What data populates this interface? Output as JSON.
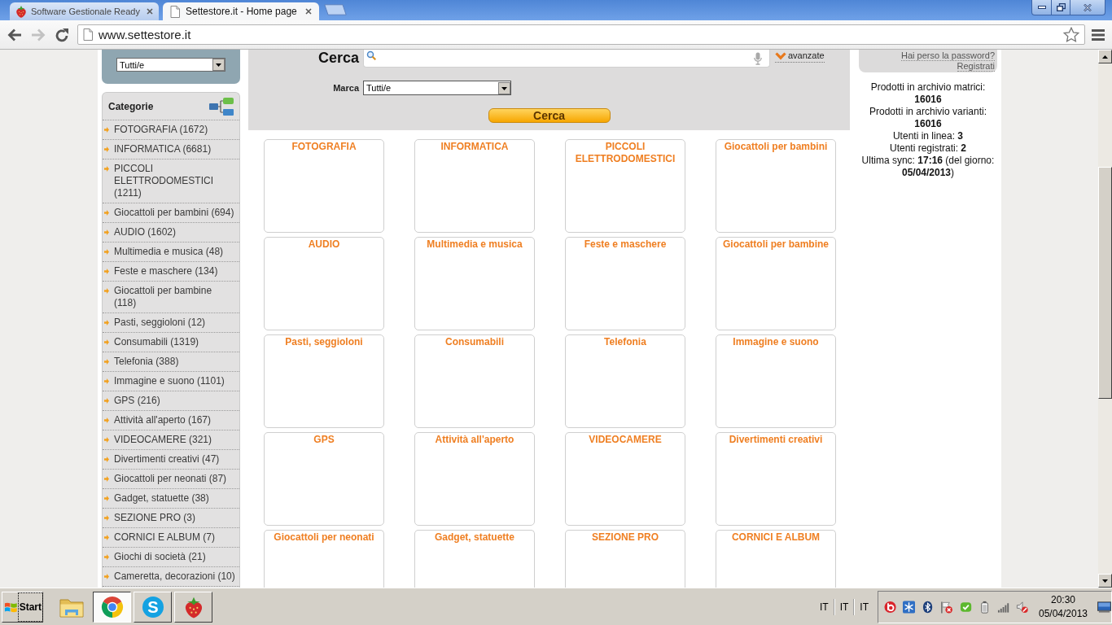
{
  "browser": {
    "tabs": [
      {
        "kind": "app",
        "title": "Software Gestionale Ready",
        "selected": false
      },
      {
        "kind": "page",
        "title": "Settestore.it - Home page",
        "selected": true
      }
    ],
    "nav": [
      {
        "kind": "back",
        "disabled": false
      },
      {
        "kind": "forward",
        "disabled": true
      },
      {
        "kind": "reload",
        "disabled": false
      }
    ],
    "address": "www.settestore.it"
  },
  "sidebar": {
    "filter_select": "Tutti/e",
    "categories_title": "Categorie",
    "items": [
      "FOTOGRAFIA (1672)",
      "INFORMATICA (6681)",
      "PICCOLI ELETTRODOMESTICI (1211)",
      "Giocattoli per bambini (694)",
      "AUDIO (1602)",
      "Multimedia e musica (48)",
      "Feste e maschere (134)",
      "Giocattoli per bambine (118)",
      "Pasti, seggioloni (12)",
      "Consumabili (1319)",
      "Telefonia (388)",
      "Immagine e suono (1101)",
      "GPS (216)",
      "Attività all'aperto (167)",
      "VIDEOCAMERE (321)",
      "Divertimenti creativi (47)",
      "Giocattoli per neonati (87)",
      "Gadget, statuette (38)",
      "SEZIONE PRO (3)",
      "CORNICI E ALBUM (7)",
      "Giochi di società (21)",
      "Cameretta, decorazioni (10)"
    ]
  },
  "search": {
    "label": "Cerca",
    "advanced_link": "avanzate",
    "brand_label": "Marca",
    "brand_select": "Tutti/e",
    "button": "Cerca"
  },
  "category_tiles": [
    "FOTOGRAFIA",
    "INFORMATICA",
    "PICCOLI ELETTRODOMESTICI",
    "Giocattoli per bambini",
    "AUDIO",
    "Multimedia e musica",
    "Feste e maschere",
    "Giocattoli per bambine",
    "Pasti, seggioloni",
    "Consumabili",
    "Telefonia",
    "Immagine e suono",
    "GPS",
    "Attività all'aperto",
    "VIDEOCAMERE",
    "Divertimenti creativi",
    "Giocattoli per neonati",
    "Gadget, statuette",
    "SEZIONE PRO",
    "CORNICI E ALBUM"
  ],
  "account": {
    "lost_password_link": "Hai perso la password?",
    "register_link": "Registrati"
  },
  "stats": [
    "Prodotti in archivio matrici: **16016**",
    "Prodotti in archivio varianti: **16016**",
    "Utenti in linea: **3**",
    "Utenti registrati: **2**",
    "Ultima sync: **17:16** (del giorno: **05/04/2013**)"
  ],
  "taskbar": {
    "start": "Start",
    "apps": [
      {
        "kind": "folder",
        "running": false,
        "selected": false
      },
      {
        "kind": "browser",
        "running": true,
        "selected": true
      },
      {
        "kind": "chat",
        "glyph": "S",
        "running": true,
        "selected": false
      },
      {
        "kind": "strawberry",
        "running": true,
        "selected": false
      }
    ],
    "languages": [
      "IT",
      "IT",
      "IT"
    ],
    "clock": {
      "time": "20:30",
      "date": "05/04/2013"
    }
  }
}
